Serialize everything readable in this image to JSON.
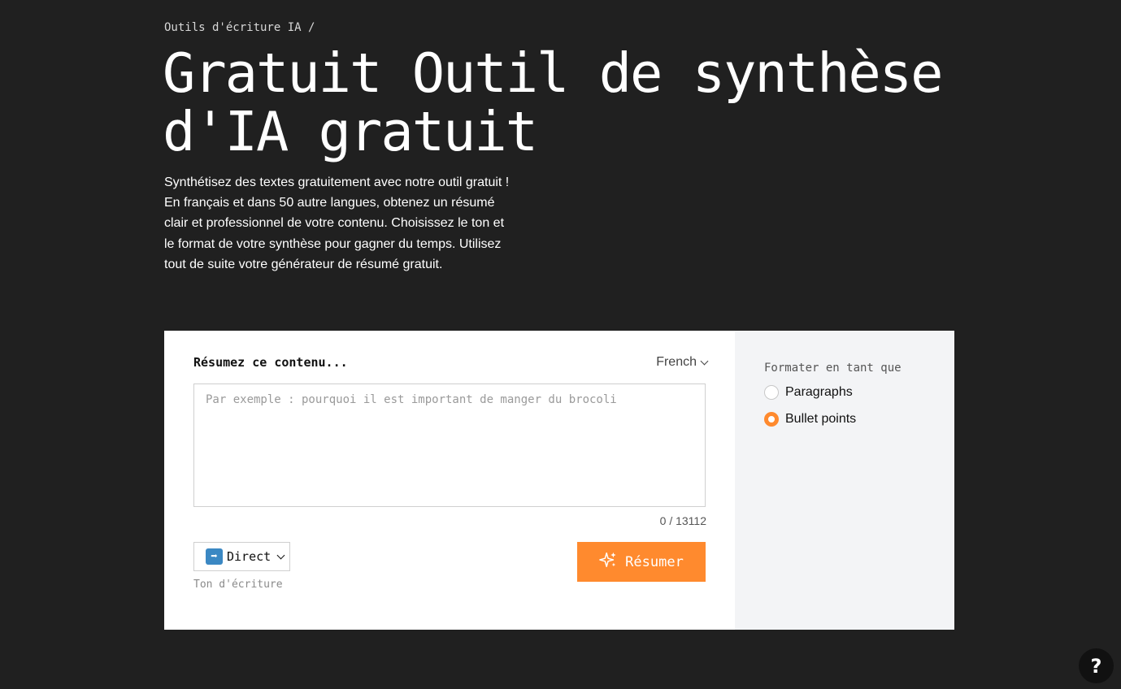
{
  "breadcrumb": {
    "parent": "Outils d'écriture IA",
    "separator": "/"
  },
  "hero": {
    "title": "Gratuit Outil de synthèse d'IA gratuit",
    "description": "Synthétisez des textes gratuitement avec notre outil gratuit ! En français et dans 50 autre langues, obtenez un résumé clair et professionnel de votre contenu. Choisissez le ton et le format de votre synthèse pour gagner du temps. Utilisez tout de suite votre générateur de résumé gratuit."
  },
  "tool": {
    "content_label": "Résumez ce contenu...",
    "language": "French",
    "input_value": "",
    "input_placeholder": "Par exemple : pourquoi il est important de manger du brocoli",
    "counter": "0 / 13112",
    "tone": {
      "emoji": "➡",
      "value": "Direct",
      "caption": "Ton d'écriture"
    },
    "submit_label": "Résumer",
    "accent_color": "#ff8a2e"
  },
  "format": {
    "label": "Formater en tant que",
    "options": [
      {
        "label": "Paragraphs",
        "checked": false
      },
      {
        "label": "Bullet points",
        "checked": true
      }
    ]
  },
  "help": {
    "label": "?"
  }
}
